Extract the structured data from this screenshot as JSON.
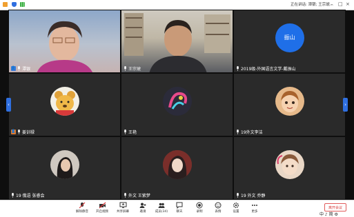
{
  "titlebar": {
    "speaking_text": "正在讲话: 潭银; 王宗琥..."
  },
  "tiles": [
    {
      "name": "潭银",
      "kind": "video1",
      "host": true
    },
    {
      "name": "王宗琥",
      "kind": "video2",
      "host": false
    },
    {
      "name": "2019级-外国语言文学-戴振山",
      "kind": "avatar-text",
      "avatar_text": "振山",
      "avatar_color": "#1f6fe8",
      "host": false
    },
    {
      "name": "姜训禄",
      "kind": "avatar",
      "avatar_icon": "pooh-bear-avatar",
      "avatar_color": "#f3f0e6",
      "host": true
    },
    {
      "name": "王艳",
      "kind": "avatar",
      "avatar_icon": "gradient-swirl-avatar",
      "avatar_color": "#2b2b3a",
      "host": false
    },
    {
      "name": "19外文李洁",
      "kind": "avatar",
      "avatar_icon": "cartoon-boy-avatar",
      "avatar_color": "#e6b98a",
      "host": false
    },
    {
      "name": "19 俄语 张睿会",
      "kind": "avatar",
      "avatar_icon": "girl-photo-avatar",
      "avatar_color": "#cfc8c0",
      "host": false
    },
    {
      "name": "外文 王紫梦",
      "kind": "avatar",
      "avatar_icon": "girl-photo-avatar",
      "avatar_color": "#6b4a3c",
      "host": false
    },
    {
      "name": "19 外文 乔静",
      "kind": "avatar",
      "avatar_icon": "child-photo-avatar",
      "avatar_color": "#e9d7c6",
      "host": false
    }
  ],
  "toolbar": {
    "items": [
      {
        "label": "解除静音",
        "icon": "mic-muted-icon"
      },
      {
        "label": "开启视频",
        "icon": "video-off-icon"
      },
      {
        "label": "共享屏幕",
        "icon": "share-screen-icon"
      },
      {
        "label": "邀请",
        "icon": "invite-icon"
      },
      {
        "label": "成员(34)",
        "icon": "members-icon"
      },
      {
        "label": "聊天",
        "icon": "chat-icon"
      },
      {
        "label": "录制",
        "icon": "record-icon"
      },
      {
        "label": "表情",
        "icon": "emoji-icon"
      },
      {
        "label": "设置",
        "icon": "settings-icon"
      },
      {
        "label": "更多",
        "icon": "more-icon"
      }
    ],
    "end_label": "离开会议"
  },
  "tray": {
    "text": "中 ♪ 简 ⚙"
  },
  "colors": {
    "accent": "#2f6fe0",
    "end": "#d93a3a",
    "background": "#0e0e0e"
  }
}
